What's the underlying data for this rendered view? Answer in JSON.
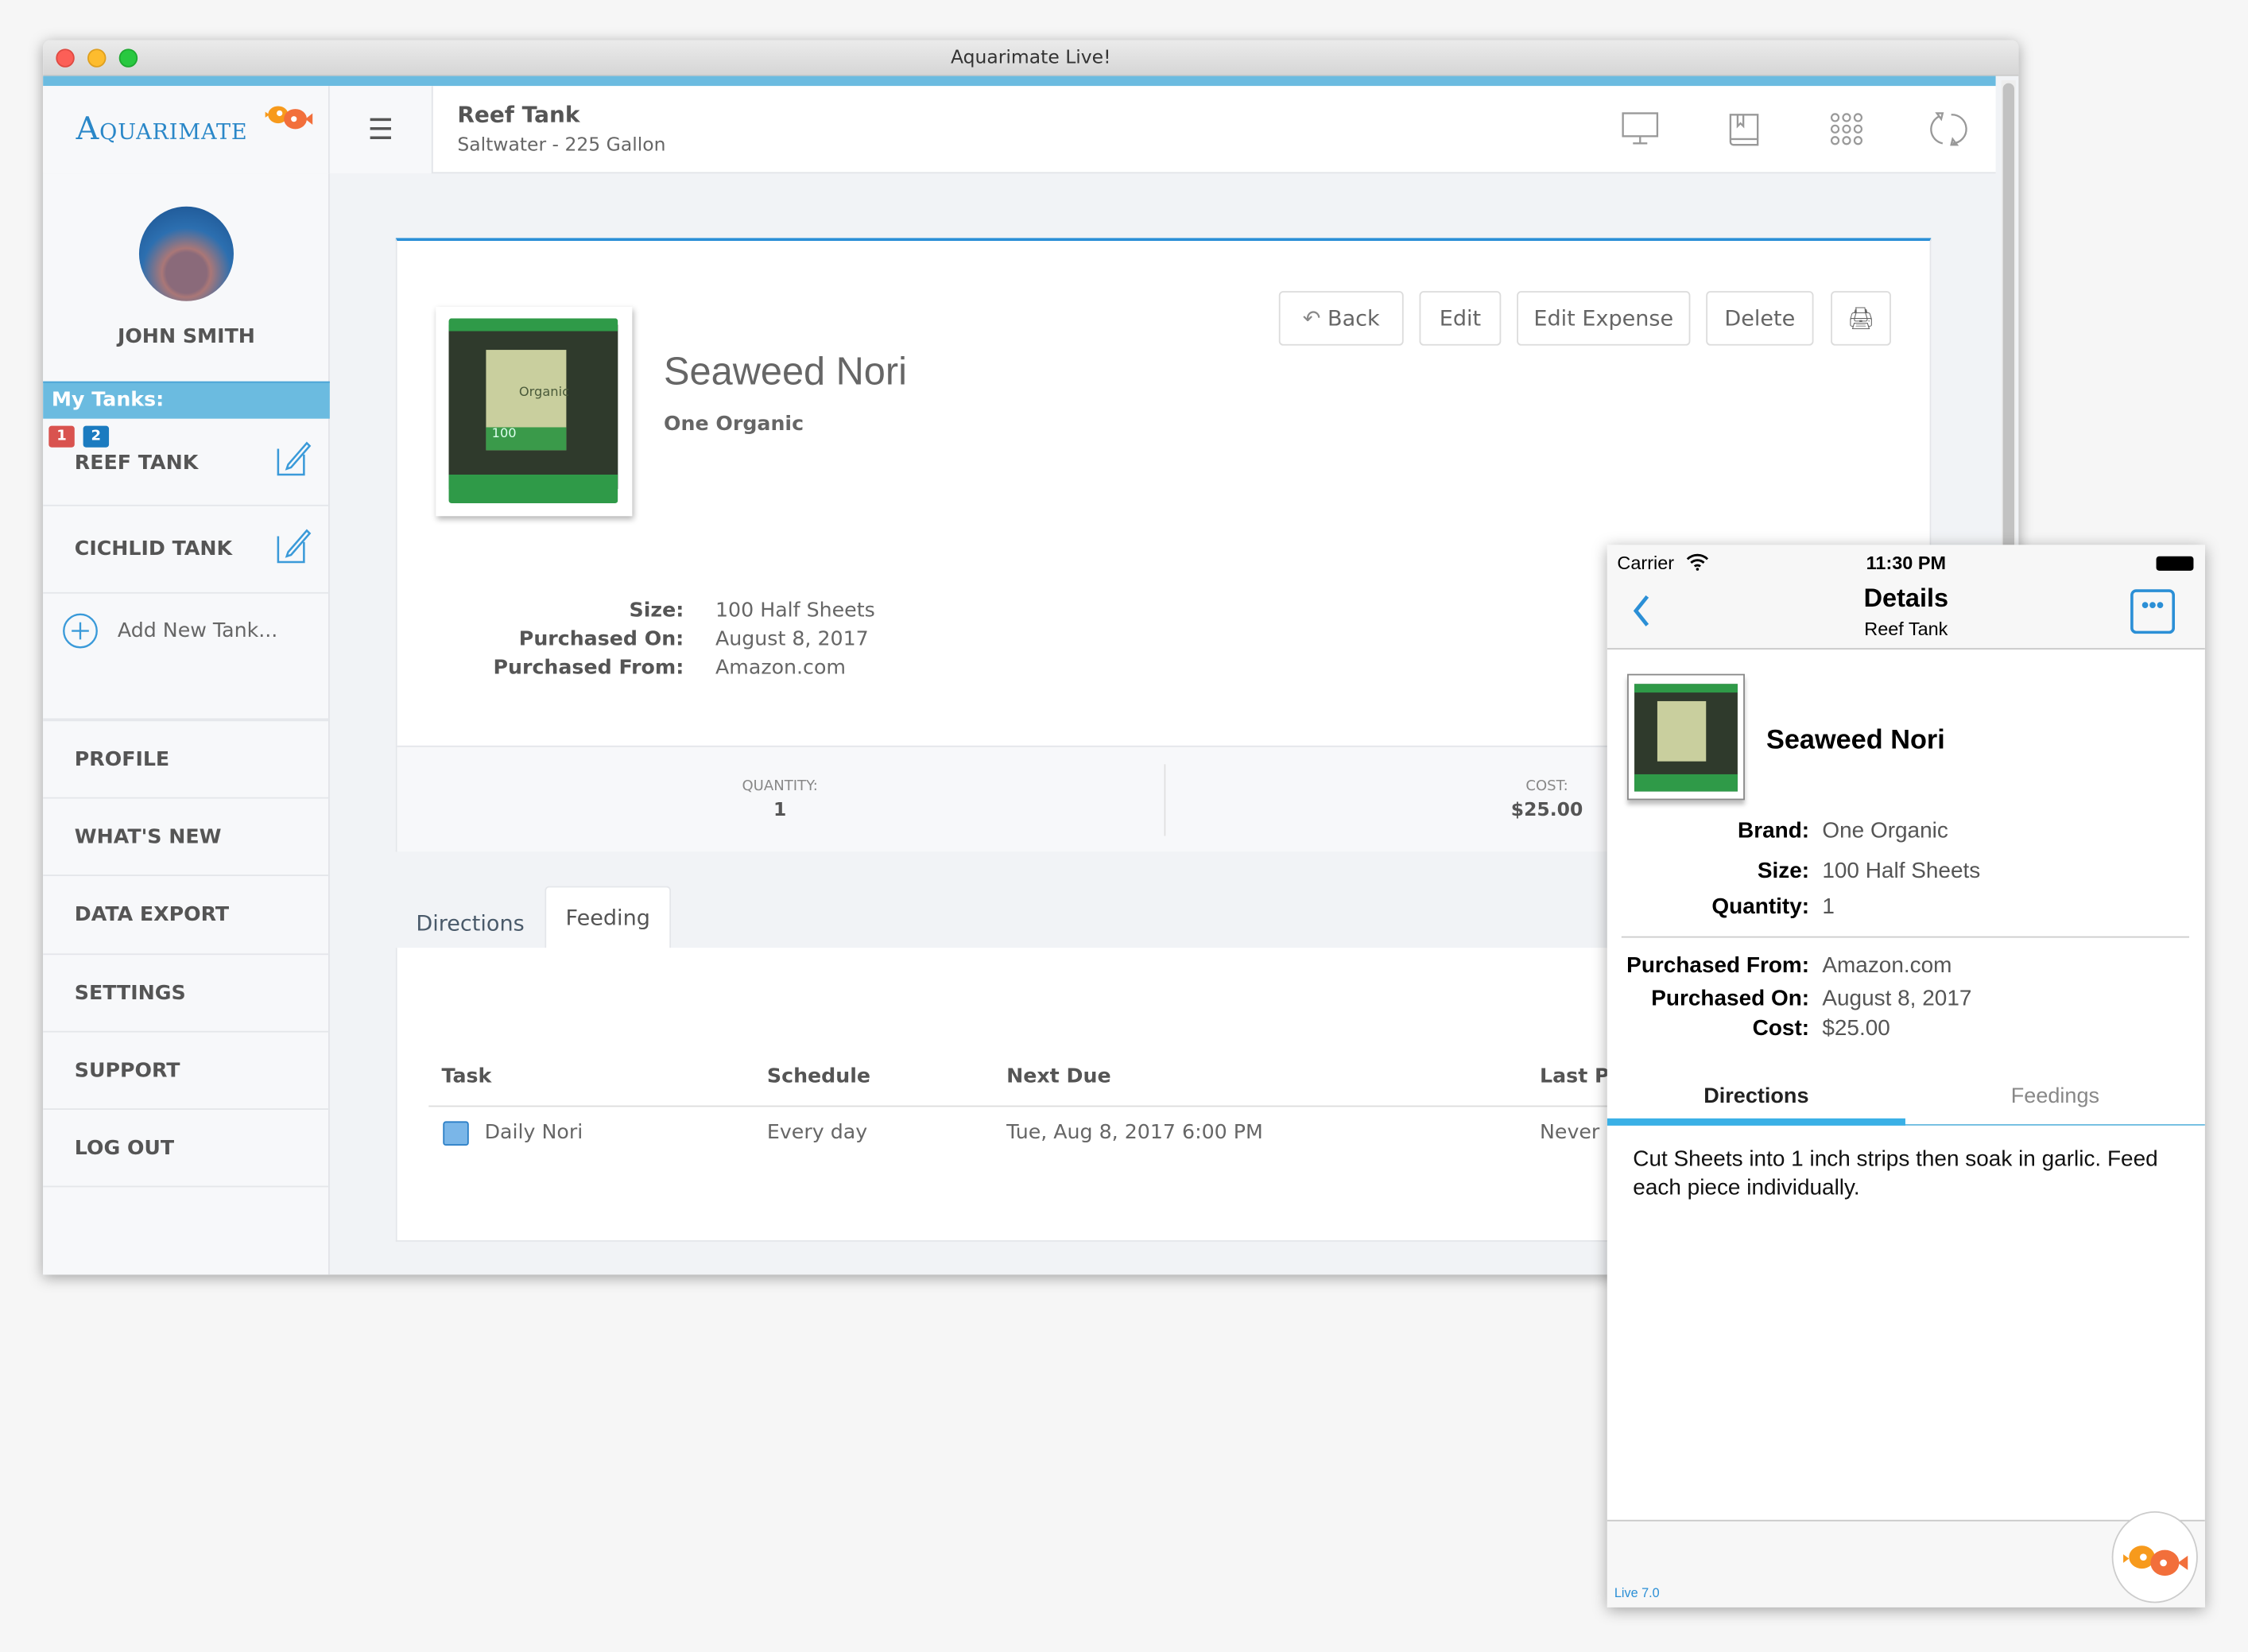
{
  "window": {
    "title": "Aquarimate Live!"
  },
  "brand": {
    "logo_text": "Aquarimate",
    "accent": "#6bbbe0",
    "link_blue": "#2b8fd6"
  },
  "header": {
    "title": "Reef Tank",
    "subtitle": "Saltwater - 225 Gallon",
    "icons": [
      "monitor-icon",
      "book-icon",
      "grid-icon",
      "sync-icon"
    ]
  },
  "sidebar": {
    "user_name": "JOHN SMITH",
    "my_tanks_label": "My Tanks:",
    "tanks": [
      {
        "name": "REEF TANK",
        "badges": [
          "1",
          "2"
        ]
      },
      {
        "name": "CICHLID TANK",
        "badges": []
      }
    ],
    "add_tank_label": "Add New Tank...",
    "menu": [
      "PROFILE",
      "WHAT'S NEW",
      "DATA EXPORT",
      "SETTINGS",
      "SUPPORT",
      "LOG OUT"
    ]
  },
  "product": {
    "name": "Seaweed Nori",
    "brand": "One Organic",
    "details": [
      {
        "label": "Size:",
        "value": "100 Half Sheets"
      },
      {
        "label": "Purchased On:",
        "value": "August 8, 2017"
      },
      {
        "label": "Purchased From:",
        "value": "Amazon.com"
      }
    ],
    "stats": {
      "quantity_label": "QUANTITY:",
      "quantity": "1",
      "cost_label": "COST:",
      "cost": "$25.00"
    }
  },
  "actions": {
    "back": "Back",
    "edit": "Edit",
    "edit_expense": "Edit Expense",
    "delete": "Delete"
  },
  "tabs": [
    "Directions",
    "Feeding"
  ],
  "active_tab": "Feeding",
  "feeding_table": {
    "headers": [
      "Task",
      "Schedule",
      "Next Due",
      "Last Pe"
    ],
    "rows": [
      [
        "Daily Nori",
        "Every day",
        "Tue, Aug 8, 2017 6:00 PM",
        "Never"
      ]
    ]
  },
  "phone": {
    "carrier": "Carrier",
    "time": "11:30 PM",
    "nav_title": "Details",
    "nav_subtitle": "Reef Tank",
    "product_name": "Seaweed Nori",
    "fields1": [
      {
        "label": "Brand:",
        "value": "One Organic"
      },
      {
        "label": "Size:",
        "value": "100 Half Sheets"
      },
      {
        "label": "Quantity:",
        "value": "1"
      }
    ],
    "fields2": [
      {
        "label": "Purchased From:",
        "value": "Amazon.com"
      },
      {
        "label": "Purchased On:",
        "value": "August 8, 2017"
      },
      {
        "label": "Cost:",
        "value": "$25.00"
      }
    ],
    "tabs": [
      "Directions",
      "Feedings"
    ],
    "active_tab": "Directions",
    "directions_text": "Cut Sheets into 1 inch strips then soak in garlic. Feed each piece individually.",
    "version": "Live 7.0"
  }
}
